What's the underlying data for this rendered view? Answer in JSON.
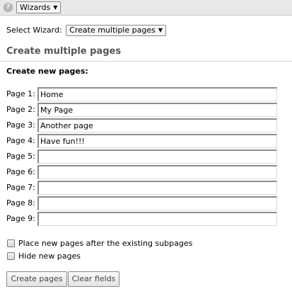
{
  "topbar": {
    "help_icon": "help-icon",
    "wizards_label": "Wizards",
    "caret": "▼"
  },
  "wizard_select": {
    "label": "Select Wizard:",
    "value": "Create multiple pages",
    "caret": "▼"
  },
  "section": {
    "title": "Create multiple pages",
    "subheading": "Create new pages:"
  },
  "pages": [
    {
      "label": "Page 1:",
      "value": "Home"
    },
    {
      "label": "Page 2:",
      "value": "My Page"
    },
    {
      "label": "Page 3:",
      "value": "Another page"
    },
    {
      "label": "Page 4:",
      "value": "Have fun!!!"
    },
    {
      "label": "Page 5:",
      "value": ""
    },
    {
      "label": "Page 6:",
      "value": ""
    },
    {
      "label": "Page 7:",
      "value": ""
    },
    {
      "label": "Page 8:",
      "value": ""
    },
    {
      "label": "Page 9:",
      "value": ""
    }
  ],
  "options": {
    "place_after_label": "Place new pages after the existing subpages",
    "place_after_checked": false,
    "hide_label": "Hide new pages",
    "hide_checked": false
  },
  "buttons": {
    "create": "Create pages",
    "clear": "Clear fields"
  }
}
